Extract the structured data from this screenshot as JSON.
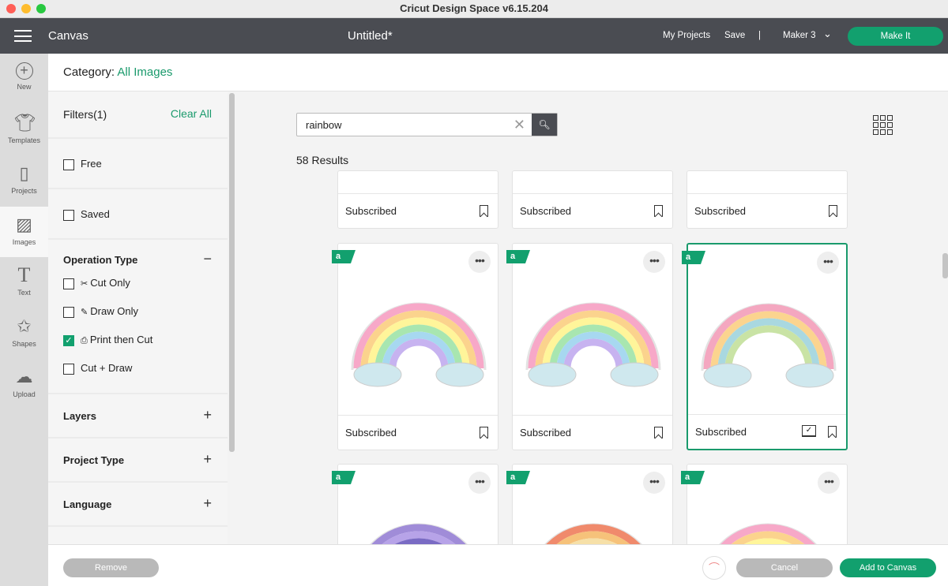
{
  "window": {
    "title": "Cricut Design Space  v6.15.204"
  },
  "nav": {
    "section": "Canvas",
    "doc_title": "Untitled*",
    "my_projects": "My Projects",
    "save": "Save",
    "separator": "|",
    "machine": "Maker 3",
    "make_it": "Make It"
  },
  "rail": [
    {
      "label": "New",
      "icon": "plus-circle-icon"
    },
    {
      "label": "Templates",
      "icon": "shirt-icon"
    },
    {
      "label": "Projects",
      "icon": "notebook-icon"
    },
    {
      "label": "Images",
      "icon": "image-icon",
      "active": true
    },
    {
      "label": "Text",
      "icon": "text-icon"
    },
    {
      "label": "Shapes",
      "icon": "shapes-icon"
    },
    {
      "label": "Upload",
      "icon": "upload-cloud-icon"
    }
  ],
  "category": {
    "label": "Category:",
    "value": "All Images"
  },
  "filters": {
    "title": "Filters(1)",
    "clear": "Clear All",
    "free": "Free",
    "saved": "Saved",
    "operation_type": {
      "title": "Operation Type",
      "options": [
        {
          "label": "Cut Only",
          "checked": false
        },
        {
          "label": "Draw Only",
          "checked": false
        },
        {
          "label": "Print then Cut",
          "checked": true
        },
        {
          "label": "Cut + Draw",
          "checked": false
        }
      ]
    },
    "sections": [
      "Layers",
      "Project Type",
      "Language"
    ]
  },
  "search": {
    "value": "rainbow",
    "results": "58 Results"
  },
  "cards": {
    "status": "Subscribed",
    "badge": "a"
  },
  "footer": {
    "remove": "Remove",
    "cancel": "Cancel",
    "add": "Add to Canvas"
  },
  "colors": {
    "accent": "#12a06e",
    "nav": "#4a4c52"
  }
}
